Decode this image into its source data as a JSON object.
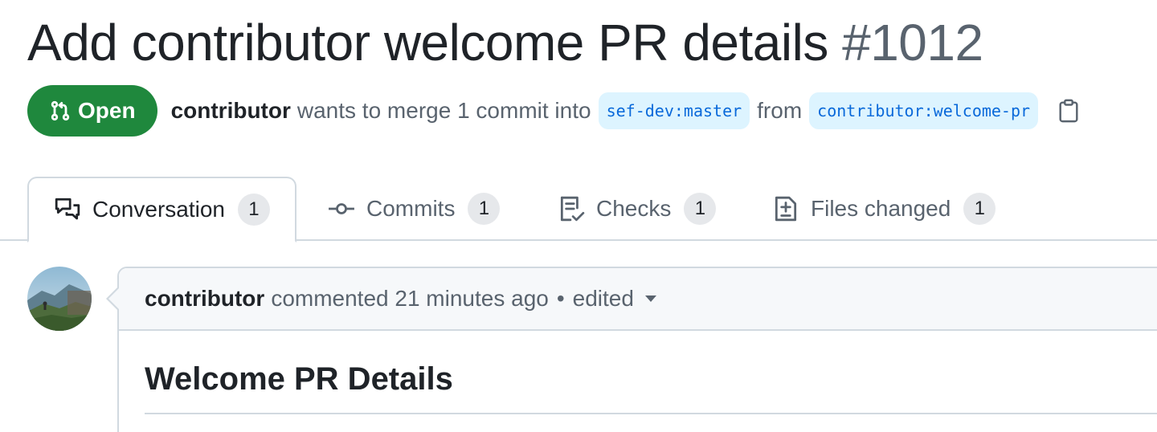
{
  "pr": {
    "title": "Add contributor welcome PR details",
    "number": "#1012",
    "state": "Open",
    "author": "contributor",
    "merge_text": "wants to merge 1 commit into",
    "base_branch": "sef-dev:master",
    "from_text": "from",
    "head_branch": "contributor:welcome-pr"
  },
  "tabs": [
    {
      "label": "Conversation",
      "count": "1",
      "icon": "comment-discussion-icon"
    },
    {
      "label": "Commits",
      "count": "1",
      "icon": "git-commit-icon"
    },
    {
      "label": "Checks",
      "count": "1",
      "icon": "checklist-icon"
    },
    {
      "label": "Files changed",
      "count": "1",
      "icon": "file-diff-icon"
    }
  ],
  "comment": {
    "author": "contributor",
    "action": "commented 21 minutes ago",
    "separator": "•",
    "edited": "edited",
    "heading": "Welcome PR Details"
  },
  "colors": {
    "open_green": "#1f883d",
    "branch_bg": "#ddf4ff",
    "branch_fg": "#0969da"
  }
}
